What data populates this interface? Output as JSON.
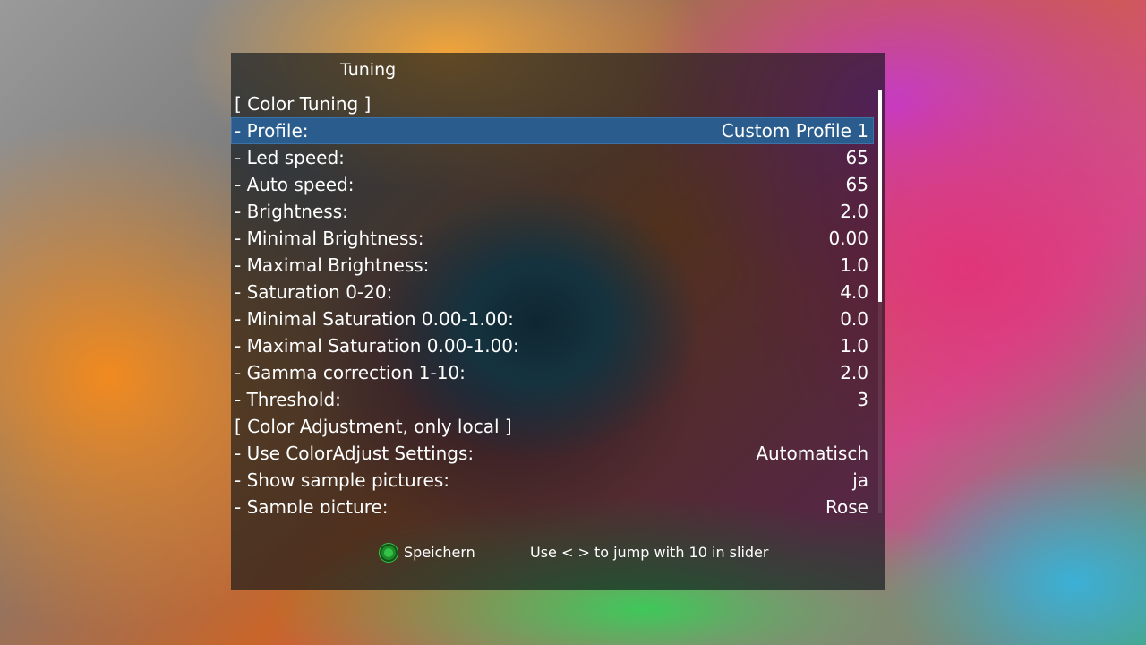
{
  "window": {
    "title": "Tuning"
  },
  "settings": {
    "items": [
      {
        "label": "[ Color Tuning ]",
        "value": "",
        "selected": false
      },
      {
        "label": "- Profile:",
        "value": "Custom Profile 1",
        "selected": true
      },
      {
        "label": "- Led speed:",
        "value": "65",
        "selected": false
      },
      {
        "label": "- Auto speed:",
        "value": "65",
        "selected": false
      },
      {
        "label": "- Brightness:",
        "value": "2.0",
        "selected": false
      },
      {
        "label": "- Minimal Brightness:",
        "value": "0.00",
        "selected": false
      },
      {
        "label": "- Maximal Brightness:",
        "value": "1.0",
        "selected": false
      },
      {
        "label": "- Saturation 0-20:",
        "value": "4.0",
        "selected": false
      },
      {
        "label": "- Minimal Saturation 0.00-1.00:",
        "value": "0.0",
        "selected": false
      },
      {
        "label": "- Maximal Saturation 0.00-1.00:",
        "value": "1.0",
        "selected": false
      },
      {
        "label": "- Gamma correction 1-10:",
        "value": "2.0",
        "selected": false
      },
      {
        "label": "- Threshold:",
        "value": "3",
        "selected": false
      },
      {
        "label": "[ Color Adjustment, only local ]",
        "value": "",
        "selected": false
      },
      {
        "label": "- Use ColorAdjust Settings:",
        "value": "Automatisch",
        "selected": false
      },
      {
        "label": "- Show sample pictures:",
        "value": "ja",
        "selected": false
      },
      {
        "label": "- Sample picture:",
        "value": "Rose",
        "selected": false
      }
    ]
  },
  "footer": {
    "save_label": "Speichern",
    "save_button_color": "#36c247",
    "hint": "Use < > to jump with 10 in slider"
  },
  "colors": {
    "selection": "#2a5d8e",
    "panel_bg": "rgba(8,16,22,0.62)"
  }
}
